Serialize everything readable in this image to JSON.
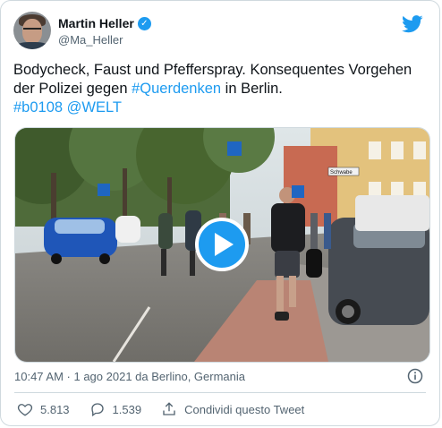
{
  "author": {
    "display_name": "Martin Heller",
    "handle": "@Ma_Heller",
    "verified_mark": "✓"
  },
  "tweet": {
    "text_parts": [
      "Bodycheck, Faust und Pfefferspray. Konsequentes Vorgehen der Polizei gegen ",
      "#Querdenken",
      " in Berlin.",
      "#b0108",
      "@WELT"
    ]
  },
  "media": {
    "street_sign": "Schwabe",
    "play_icon": "play-icon"
  },
  "meta": {
    "timestamp": "10:47 AM · 1 ago 2021 da Berlino, Germania",
    "info_icon": "info-icon"
  },
  "actions": {
    "likes": "5.813",
    "replies": "1.539",
    "share_label": "Condividi questo Tweet"
  },
  "colors": {
    "accent": "#1d9bf0",
    "text_primary": "#0f1419",
    "text_secondary": "#536471",
    "border": "#cfd9de"
  }
}
